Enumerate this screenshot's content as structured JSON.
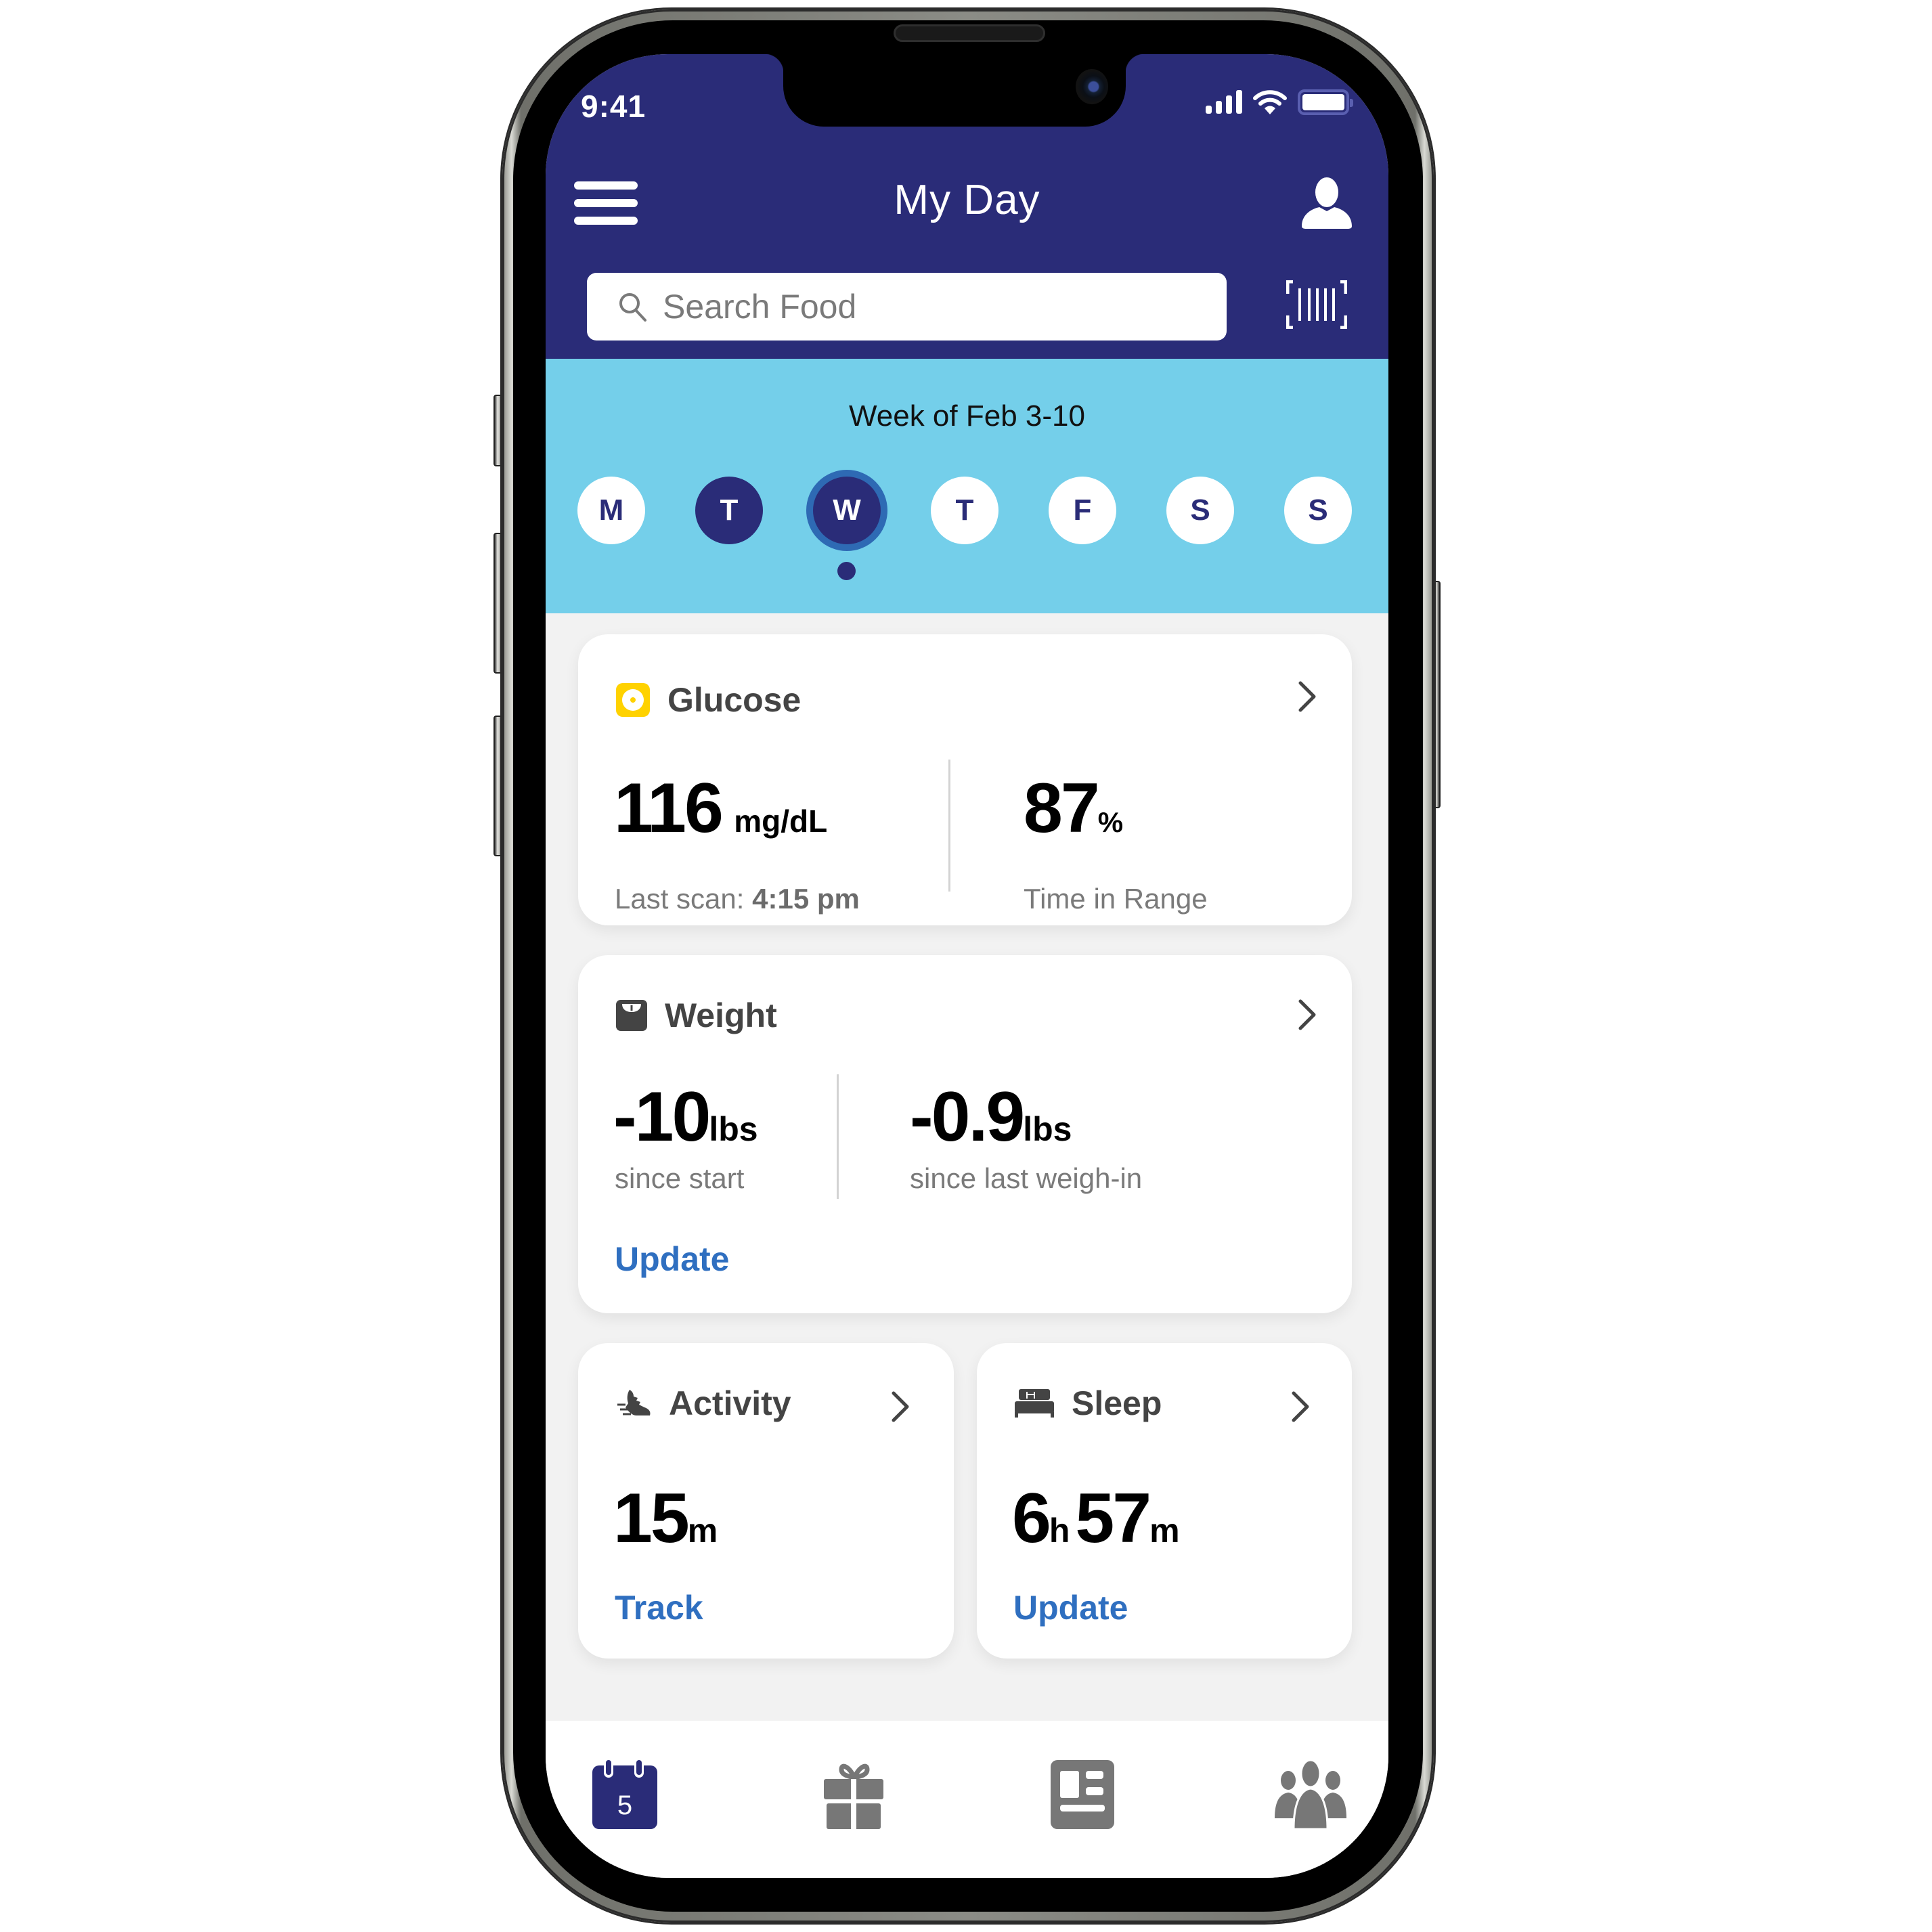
{
  "status_bar": {
    "time": "9:41",
    "icons": [
      "cellular-signal-icon",
      "wifi-icon",
      "battery-icon"
    ]
  },
  "header": {
    "title": "My Day",
    "menu_icon": "hamburger-menu-icon",
    "profile_icon": "user-profile-icon",
    "barcode_icon": "barcode-scan-icon"
  },
  "search": {
    "placeholder": "Search Food",
    "value": "",
    "icon": "search-icon"
  },
  "week": {
    "title": "Week of Feb 3-10",
    "days": [
      {
        "label": "M",
        "state": "default"
      },
      {
        "label": "T",
        "state": "done"
      },
      {
        "label": "W",
        "state": "selected"
      },
      {
        "label": "T",
        "state": "default"
      },
      {
        "label": "F",
        "state": "default"
      },
      {
        "label": "S",
        "state": "default"
      },
      {
        "label": "S",
        "state": "default"
      }
    ],
    "today_index": 2
  },
  "cards": {
    "glucose": {
      "title": "Glucose",
      "icon": "glucose-sensor-icon",
      "value": "116",
      "unit": "mg/dL",
      "last_scan_label": "Last scan:",
      "last_scan_time": "4:15 pm",
      "time_in_range_value": "87",
      "time_in_range_unit": "%",
      "time_in_range_label": "Time in Range"
    },
    "weight": {
      "title": "Weight",
      "icon": "scale-icon",
      "since_start_value": "-10",
      "since_start_unit": "lbs",
      "since_start_label": "since start",
      "since_last_value": "-0.9",
      "since_last_unit": "lbs",
      "since_last_label": "since last weigh-in",
      "action": "Update"
    },
    "activity": {
      "title": "Activity",
      "icon": "running-shoe-icon",
      "value": "15",
      "unit": "m",
      "action": "Track"
    },
    "sleep": {
      "title": "Sleep",
      "icon": "bed-icon",
      "hours": "6",
      "hours_unit": "h",
      "minutes": "57",
      "minutes_unit": "m",
      "action": "Update"
    }
  },
  "bottom_nav": {
    "items": [
      {
        "name": "my-day",
        "icon": "calendar-icon",
        "badge": "5",
        "active": true
      },
      {
        "name": "rewards",
        "icon": "gift-icon",
        "active": false
      },
      {
        "name": "articles",
        "icon": "article-icon",
        "active": false
      },
      {
        "name": "community",
        "icon": "community-icon",
        "active": false
      }
    ]
  },
  "colors": {
    "header": "#2a2c78",
    "week_bg": "#74cfea",
    "link": "#2f6fc0",
    "glucose_icon": "#ffd200",
    "selected_ring": "#2e6ab4",
    "inactive_icon": "#777777"
  }
}
